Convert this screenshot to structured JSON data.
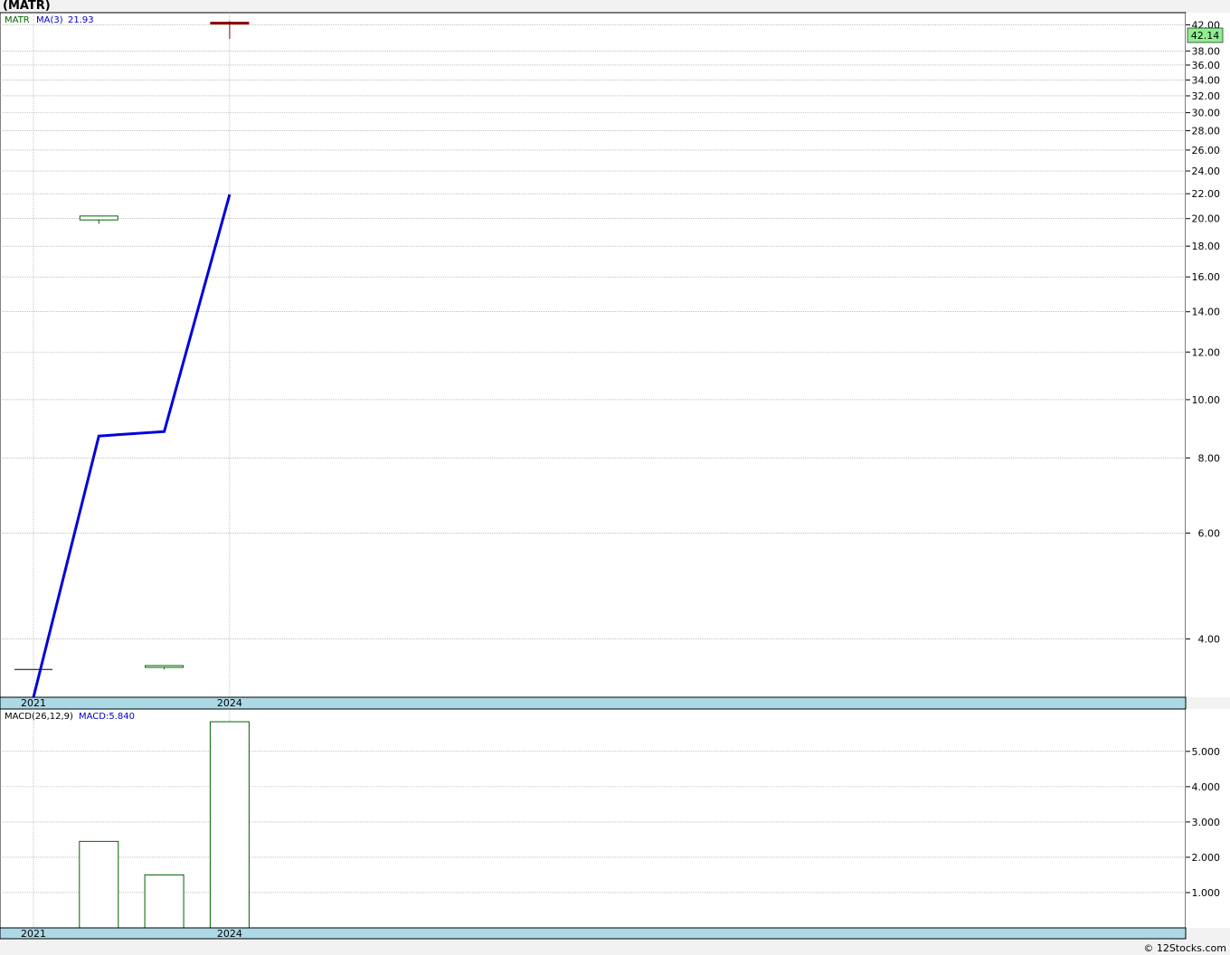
{
  "page": {
    "title": "(MATR)",
    "credit": "© 12Stocks.com"
  },
  "colors": {
    "ma_line": "#0000dd",
    "candle_up": "#006400",
    "candle_down": "#8b0000",
    "last_price_bg": "#90ee90",
    "axis_band": "#add8e6",
    "legend_ticker": "#006400",
    "legend_indicator": "#0000cc"
  },
  "price_panel": {
    "legend": {
      "ticker": "MATR",
      "ma_label": "MA(3)",
      "ma_value": "21.93"
    },
    "last_price_label": "42.14"
  },
  "macd_panel": {
    "legend": {
      "name": "MACD(26,12,9)",
      "value_label": "MACD:5.840"
    }
  },
  "chart_data": [
    {
      "type": "candlestick",
      "yscale": "log",
      "ylim": [
        3.2,
        44
      ],
      "yticks": [
        4,
        6,
        8,
        10,
        12,
        14,
        16,
        18,
        20,
        22,
        24,
        26,
        28,
        30,
        32,
        34,
        36,
        38,
        42
      ],
      "ytick_labels": [
        "4.00",
        "6.00",
        "8.00",
        "10.00",
        "12.00",
        "14.00",
        "16.00",
        "18.00",
        "20.00",
        "22.00",
        "24.00",
        "26.00",
        "28.00",
        "30.00",
        "32.00",
        "34.00",
        "36.00",
        "38.00",
        "42.00"
      ],
      "xtick_labels": [
        {
          "label": "2021",
          "bar": 0
        },
        {
          "label": "2024",
          "bar": 3
        }
      ],
      "bars": [
        {
          "open": 3.56,
          "high": 3.56,
          "low": 3.56,
          "close": 3.56,
          "dir": "flat"
        },
        {
          "open": 19.9,
          "high": 20.2,
          "low": 19.6,
          "close": 20.2,
          "dir": "up"
        },
        {
          "open": 3.6,
          "high": 3.6,
          "low": 3.56,
          "close": 3.6,
          "dir": "up"
        },
        {
          "open": 42.4,
          "high": 42.6,
          "low": 39.8,
          "close": 42.14,
          "dir": "down"
        }
      ],
      "ma": {
        "name": "MA(3)",
        "values": [
          3.2,
          8.7,
          8.85,
          21.93
        ]
      },
      "grid": true
    },
    {
      "type": "bar",
      "series": [
        {
          "name": "MACD(26,12,9)",
          "values": [
            0,
            2.45,
            1.5,
            5.84
          ]
        }
      ],
      "ylim": [
        0,
        6.2
      ],
      "yticks": [
        1,
        2,
        3,
        4,
        5
      ],
      "ytick_labels": [
        "1.000",
        "2.000",
        "3.000",
        "4.000",
        "5.000"
      ],
      "xtick_labels": [
        {
          "label": "2021",
          "bar": 0
        },
        {
          "label": "2024",
          "bar": 3
        }
      ],
      "grid": true
    }
  ]
}
